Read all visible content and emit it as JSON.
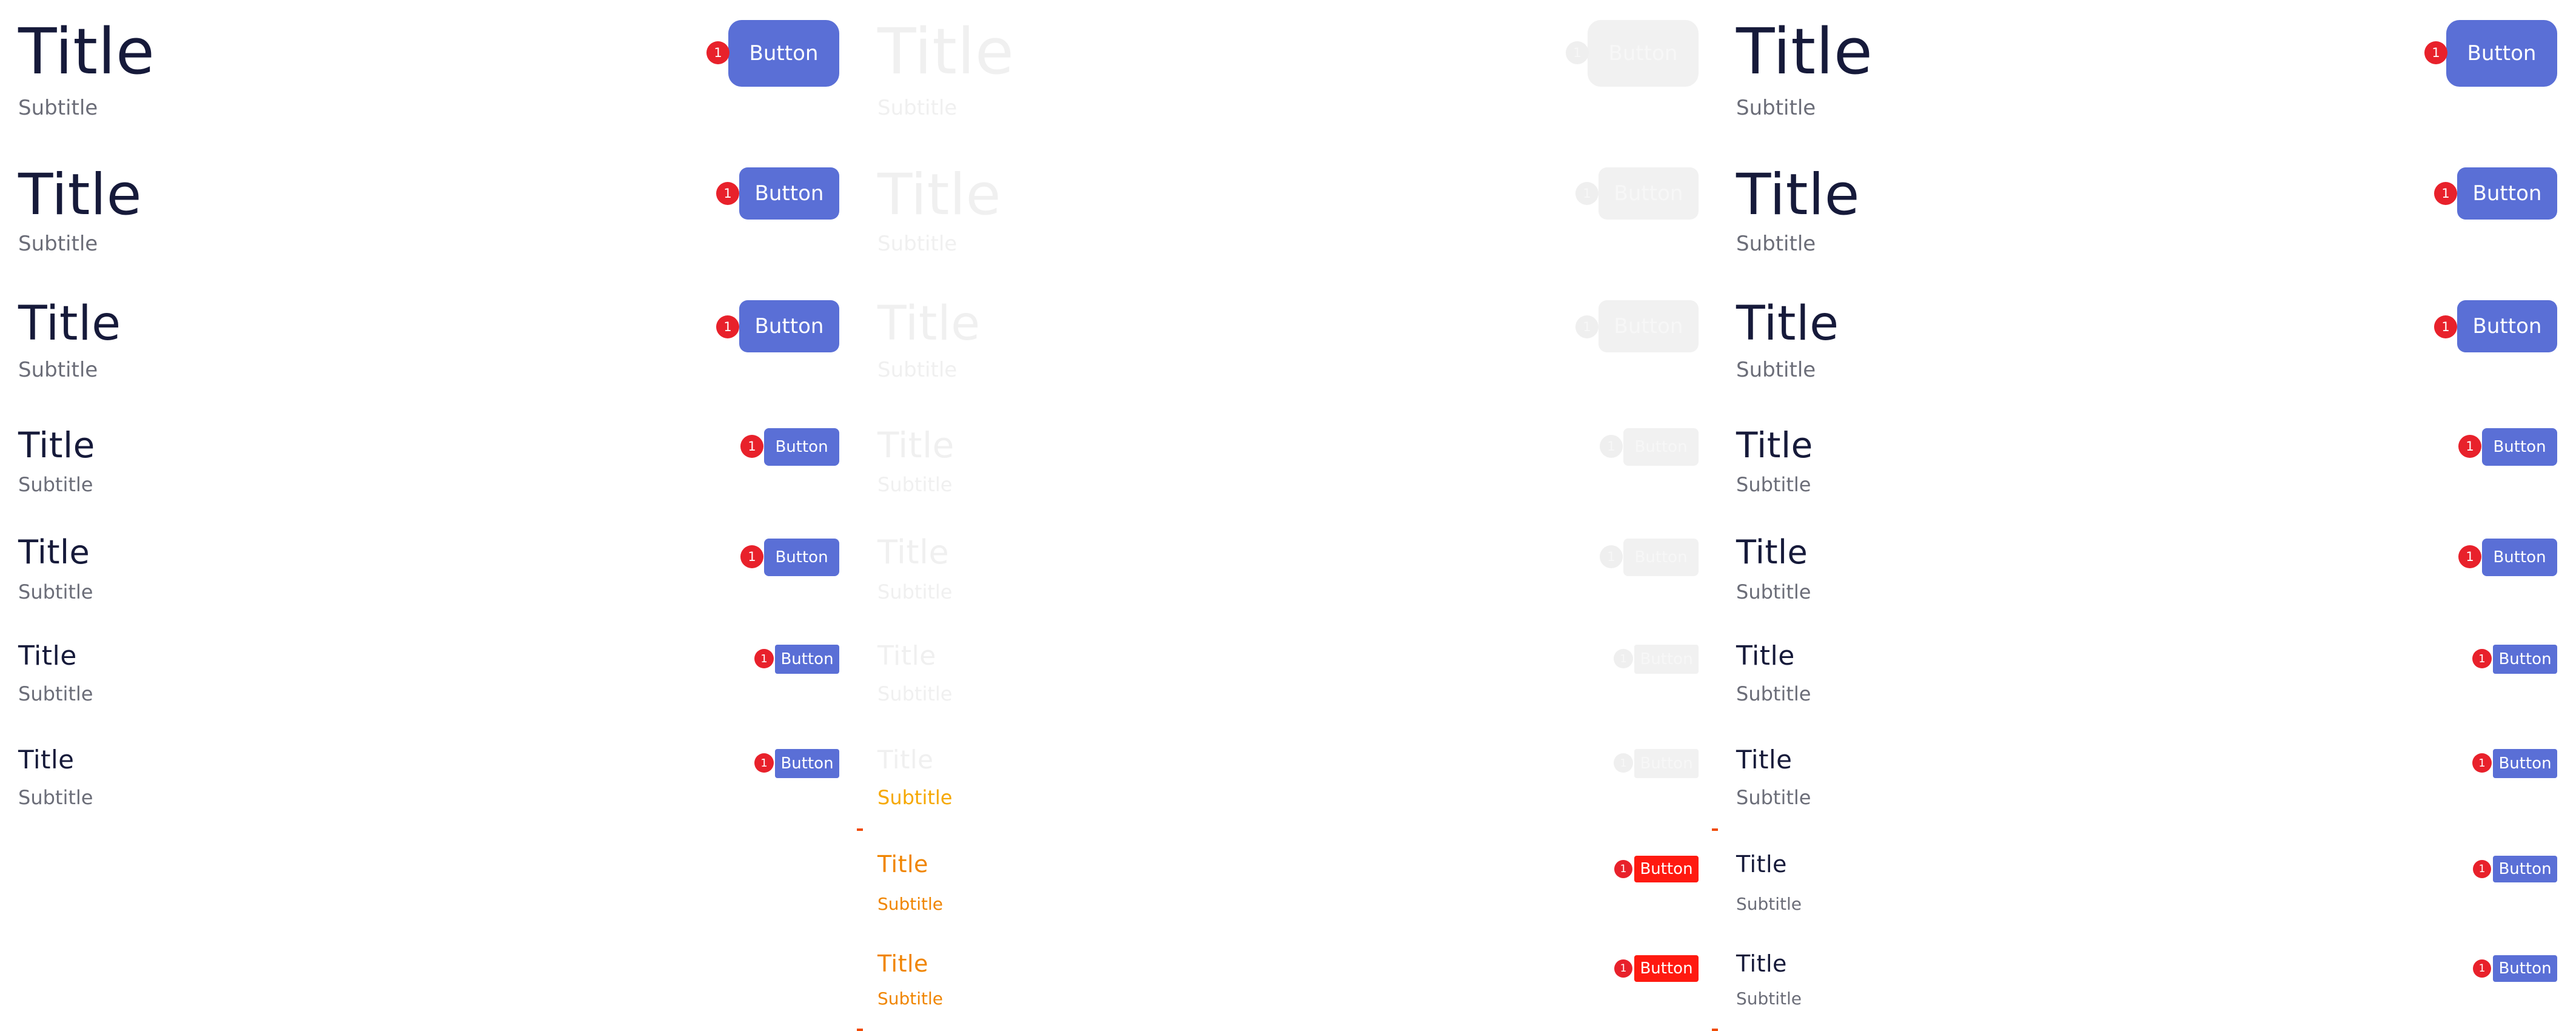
{
  "title_text": "Title",
  "subtitle_text": "Subtitle",
  "button_label": "Button",
  "badge_count": "1",
  "colors": {
    "primary_button": "#5a6fd6",
    "title": "#161a3a",
    "subtitle": "#6b6d78",
    "badge": "#e8212b",
    "danger_button": "#ff1a10",
    "danger_text": "#f08500"
  }
}
